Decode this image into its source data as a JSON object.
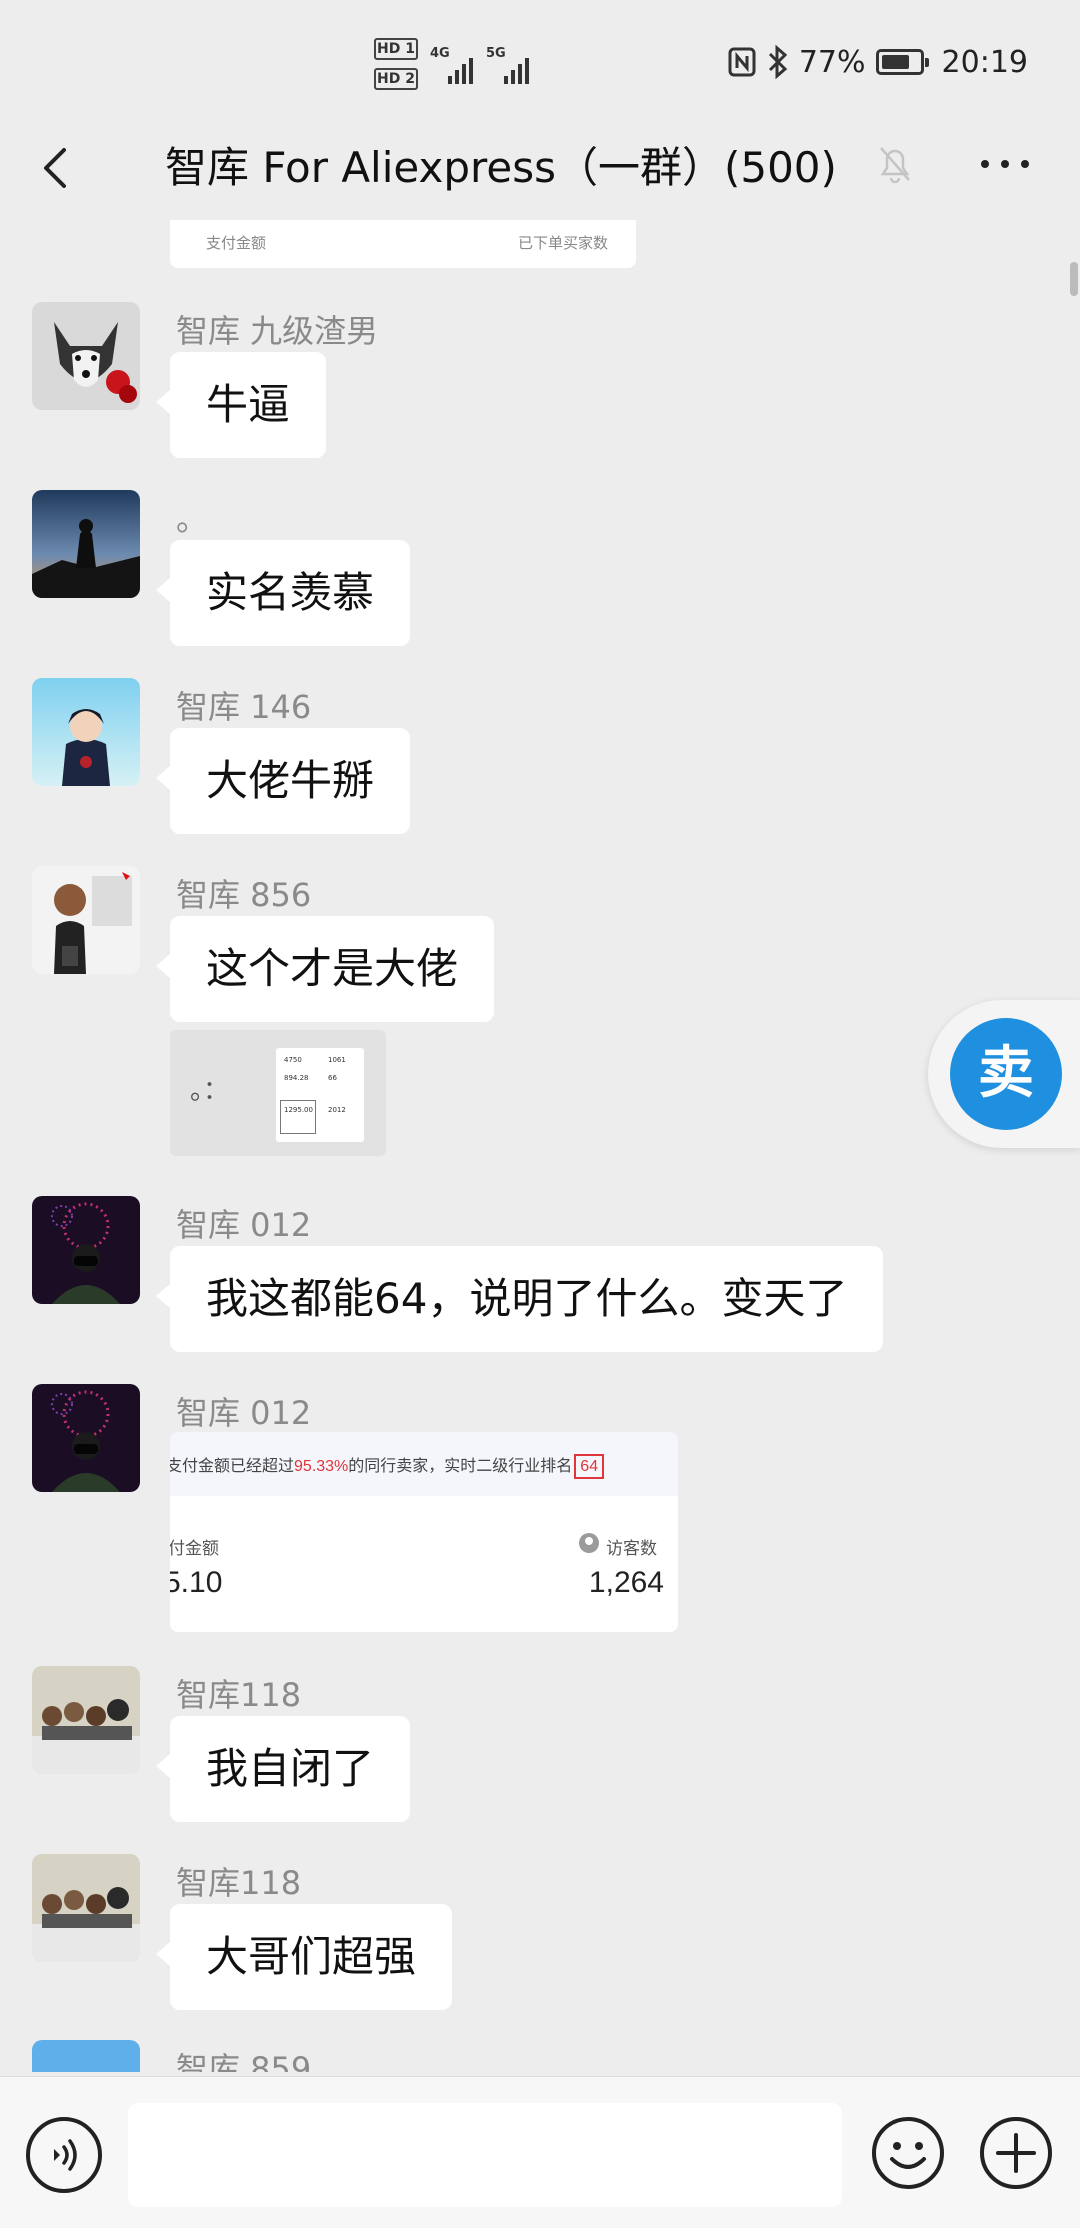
{
  "status_bar": {
    "sim1": "HD 1",
    "sim2": "HD 2",
    "net1": "4G",
    "net2": "5G",
    "battery": "77%",
    "battery_fraction": 0.77,
    "time": "20:19"
  },
  "header": {
    "title": "智库 For Aliexpress（一群）(500)",
    "icons": [
      "back-chevron-icon",
      "mute-bell-icon",
      "more-dots-icon"
    ]
  },
  "previous_card": {
    "left_text": "支付金额",
    "right_text": "已下单买家数"
  },
  "messages": [
    {
      "sender": "智库 九级渣男",
      "text": "牛逼"
    },
    {
      "sender": "。",
      "text": "实名羡慕"
    },
    {
      "sender": "智库 146",
      "text": "大佬牛掰"
    },
    {
      "sender": "智库 856",
      "text": "这个才是大佬"
    },
    {
      "sender": "智库 012",
      "text": "我这都能64，说明了什么。变天了"
    },
    {
      "sender": "智库 012",
      "text": ""
    },
    {
      "sender": "智库118",
      "text": "我自闭了"
    },
    {
      "sender": "智库118",
      "text": "大哥们超强"
    },
    {
      "sender": "智库 859",
      "text": ""
    }
  ],
  "thumb_image": {
    "glyph_left": "。：",
    "values": [
      "4750",
      "1061",
      "894.28",
      "66",
      "1295.00",
      "2012"
    ]
  },
  "stat_image": {
    "headline_pre": "支付金额已经超过",
    "headline_pct": "95.33%",
    "headline_mid": "的同行卖家，实时二级行业排名",
    "headline_rank": "64",
    "left_label": "付金额",
    "right_label": "访客数",
    "left_value": "5.10",
    "right_value": "1,264"
  },
  "float_button": {
    "label": "卖",
    "color": "#1f8fe0"
  },
  "input_bar": {
    "placeholder": "",
    "icons": [
      "voice-icon",
      "emoji-icon",
      "plus-icon"
    ]
  },
  "colors": {
    "background": "#ededed",
    "bubble": "#ffffff",
    "highlight_red": "#e0353a"
  }
}
